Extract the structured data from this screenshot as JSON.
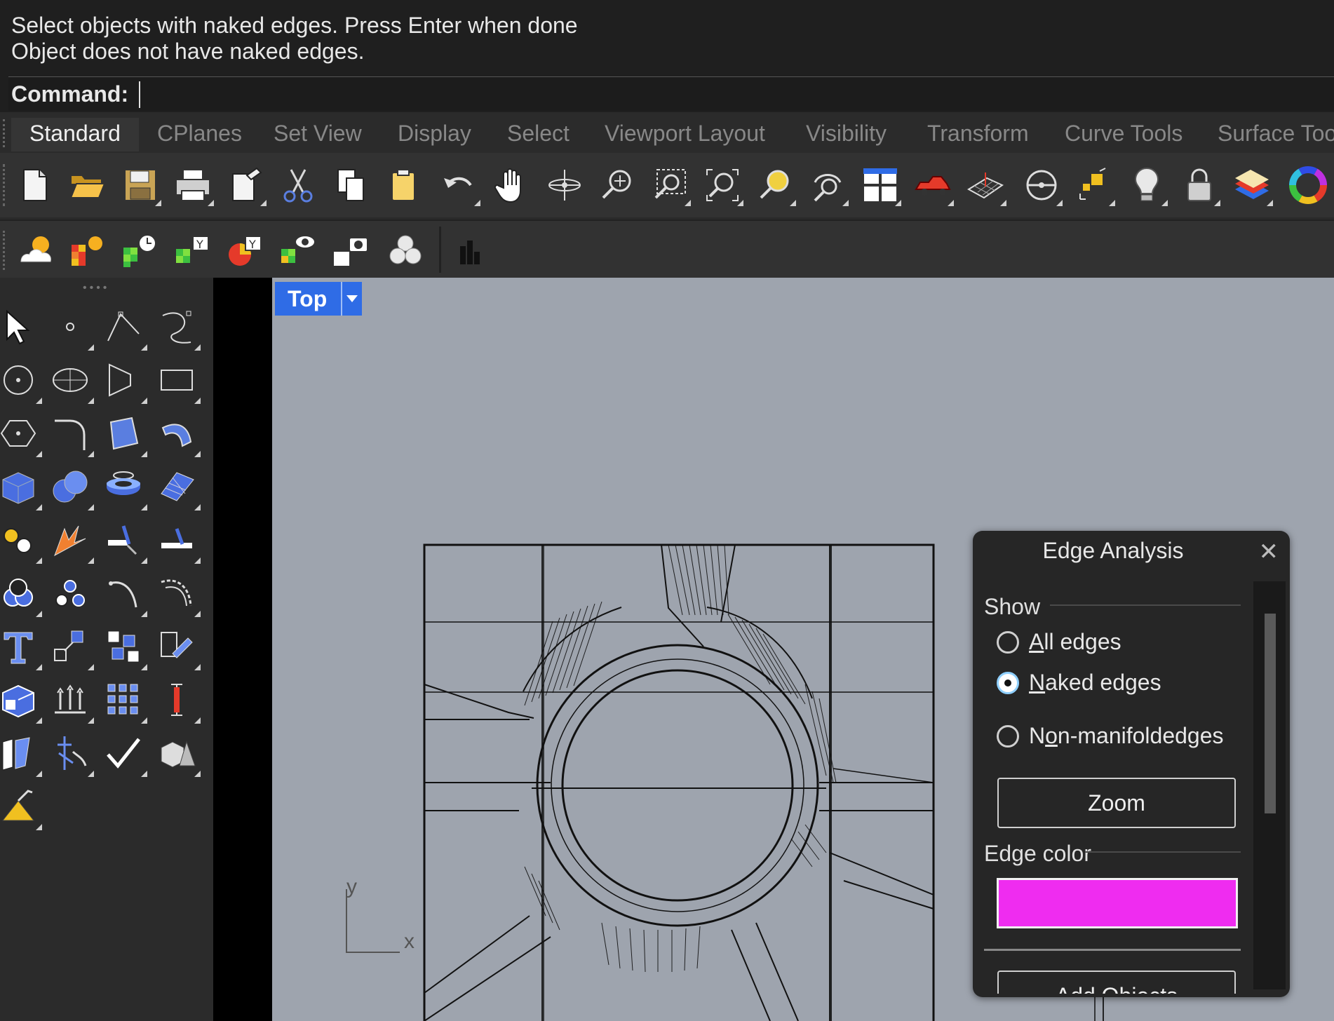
{
  "command": {
    "line1": "Select objects with naked edges. Press Enter when done",
    "line2": "Object does not have naked edges.",
    "prompt_label": "Command:",
    "input_value": ""
  },
  "tabs": [
    "Standard",
    "CPlanes",
    "Set View",
    "Display",
    "Select",
    "Viewport Layout",
    "Visibility",
    "Transform",
    "Curve Tools",
    "Surface Too"
  ],
  "active_tab": "Standard",
  "toolbar_standard_icons": [
    "new-document-icon",
    "open-folder-icon",
    "save-icon",
    "print-icon",
    "import-icon",
    "cut-icon",
    "copy-icon",
    "paste-icon",
    "undo-icon",
    "pan-hand-icon",
    "rotate-view-icon",
    "zoom-in-icon",
    "zoom-window-icon",
    "zoom-extents-icon",
    "zoom-selected-icon",
    "rotate-camera-icon",
    "four-viewports-icon",
    "car-render-icon",
    "grid-plane-icon",
    "osnap-icon",
    "gumball-icon",
    "light-bulb-icon",
    "lock-icon",
    "layers-icon",
    "color-wheel-icon"
  ],
  "toolbar_secondary_icons": [
    "sun-icon",
    "sun-grid-icon",
    "clock-grid-icon",
    "y-grid-icon",
    "y-pie-icon",
    "eye-grid-icon",
    "camera-grid-icon",
    "spheres-cluster-icon",
    "bar-chart-icon"
  ],
  "viewport": {
    "name": "Top",
    "axis_y": "y",
    "axis_x": "x"
  },
  "edge_analysis": {
    "title": "Edge Analysis",
    "show_label": "Show",
    "options": [
      {
        "label": "All edges",
        "mnemonic": "A",
        "rest": "ll edges",
        "selected": false
      },
      {
        "label": "Naked edges",
        "mnemonic": "N",
        "rest": "aked edges",
        "selected": true
      },
      {
        "label": "Non-manifoldedges",
        "mnemonic_pre": "N",
        "mnemonic": "o",
        "rest": "n-manifoldedges",
        "selected": false
      }
    ],
    "zoom_label": "Zoom",
    "edge_color_label": "Edge color",
    "edge_color": "#ef2cf0",
    "add_objects_label": "Add Objects"
  },
  "colors": {
    "viewport_bg": "#9ea4ae",
    "viewport_tab": "#2f6ce6",
    "panel_bg": "#2b2b2b"
  }
}
